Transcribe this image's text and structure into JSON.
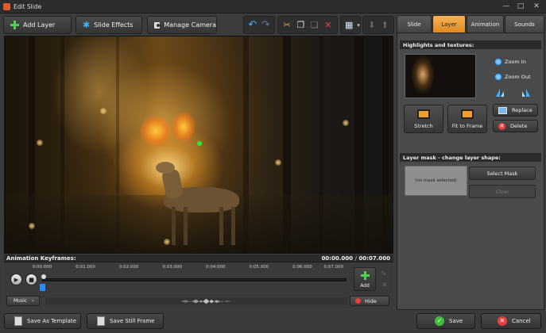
{
  "window": {
    "title": "Edit Slide",
    "minimize": "—",
    "maximize": "□",
    "close": "✕"
  },
  "toolbar": {
    "add_layer": "Add Layer",
    "slide_effects": "Slide Effects",
    "manage_camera": "Manage Camera",
    "undo_glyph": "↶",
    "redo_glyph": "↷",
    "cut_glyph": "✂",
    "copy_glyph": "❐",
    "paste_glyph": "❏",
    "delete_glyph": "✕",
    "grid_glyph": "▦",
    "dropdown_glyph": "▾",
    "move_down_glyph": "⬇",
    "move_up_glyph": "⬆"
  },
  "keyframes": {
    "header": "Animation Keyframes:",
    "time_current": "00:00.000",
    "time_separator": "/",
    "time_total": "00:07.000",
    "ticks": [
      "0:00.000",
      "0:01.000",
      "0:02.000",
      "0:03.000",
      "0:04.000",
      "0:05.000",
      "0:06.000",
      "0:07.000"
    ],
    "play_glyph": "▶",
    "stop_glyph": "■",
    "add_label": "Add",
    "music_label": "Music",
    "music_arrow": "›",
    "hide_label": "Hide"
  },
  "tabs": [
    {
      "label": "Slide",
      "active": false
    },
    {
      "label": "Layer",
      "active": true
    },
    {
      "label": "Animation",
      "active": false
    },
    {
      "label": "Sounds",
      "active": false
    }
  ],
  "layer_panel": {
    "highlights_header": "Highlights and textures:",
    "zoom_in": "Zoom In",
    "zoom_out": "Zoom Out",
    "stretch": "Stretch",
    "fit_to_frame": "Fit to Frame",
    "replace": "Replace",
    "delete": "Delete",
    "mask_header": "Layer mask - change layer shape:",
    "no_mask": "(no mask selected)",
    "select_mask": "Select Mask",
    "clear": "Clear"
  },
  "bottom": {
    "save_as_template": "Save As Template",
    "save_still_frame": "Save Still Frame",
    "save": "Save",
    "cancel": "Cancel"
  },
  "colors": {
    "accent_tab": "#e08a20",
    "add_green": "#4fd14f",
    "delete_red": "#e84040"
  }
}
